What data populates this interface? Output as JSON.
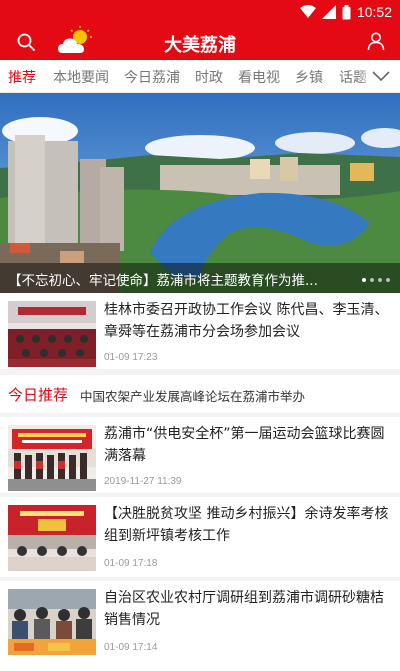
{
  "status_bar": {
    "time": "10:52",
    "icons": [
      "wifi-icon",
      "signal-icon",
      "battery-icon"
    ]
  },
  "header": {
    "title": "大美荔浦",
    "icons": [
      "search-icon",
      "weather-icon",
      "user-icon"
    ]
  },
  "tabs": [
    "推荐",
    "本地要闻",
    "今日荔浦",
    "时政",
    "看电视",
    "乡镇",
    "话题"
  ],
  "active_tab": "推荐",
  "banner": {
    "caption": "【不忘初心、牢记使命】荔浦市将主题教育作为推..."
  },
  "recommend": {
    "label": "今日推荐",
    "text": "中国农架产业发展高峰论坛在荔浦市举办"
  },
  "news": [
    {
      "title": "桂林市委召开政协工作会议 陈代昌、李玉清、章舜等在荔浦市分会场参加会议",
      "date": "01-09 17:23"
    },
    {
      "title": "荔浦市“供电安全杯”第一届运动会篮球比赛圆满落幕",
      "date": "2019-11-27 11:39"
    },
    {
      "title": "【决胜脱贫攻坚 推动乡村振兴】余诗发率考核组到新坪镇考核工作",
      "date": "01-09 17:18"
    },
    {
      "title": "自治区农业农村厅调研组到荔浦市调研砂糖桔销售情况",
      "date": "01-09 17:14"
    }
  ],
  "colors": {
    "brand": "#e30a14",
    "separator": "#f3f3f3",
    "meta_text": "#999999"
  }
}
